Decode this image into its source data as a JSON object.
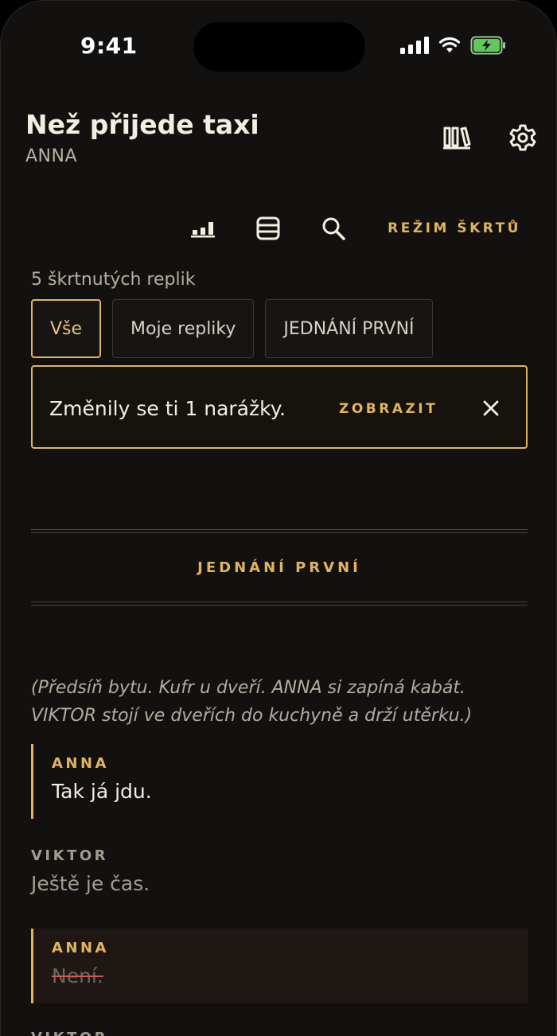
{
  "status_bar": {
    "time": "9:41"
  },
  "header": {
    "title": "Než přijede taxi",
    "subtitle": "ANNA"
  },
  "toolbar": {
    "cut_mode_label": "REŽIM ŠKRTŮ"
  },
  "cut_count": "5 škrtnutých replik",
  "filters": [
    {
      "label": "Vše",
      "active": true
    },
    {
      "label": "Moje repliky",
      "active": false
    },
    {
      "label": "JEDNÁNÍ PRVNÍ",
      "active": false
    }
  ],
  "notice": {
    "text": "Změnily se ti 1 narážky.",
    "action": "ZOBRAZIT"
  },
  "section": {
    "title": "JEDNÁNÍ PRVNÍ"
  },
  "stage_direction": "(Předsíň bytu. Kufr u dveří. ANNA si zapíná kabát. VIKTOR stojí ve dveřích do kuchyně a drží utěrku.)",
  "lines": [
    {
      "speaker": "ANNA",
      "text": "Tak já jdu.",
      "mine": true,
      "cut": false
    },
    {
      "speaker": "VIKTOR",
      "text": "Ještě je čas.",
      "mine": false,
      "cut": false
    },
    {
      "speaker": "ANNA",
      "text": "Není.",
      "mine": true,
      "cut": true
    },
    {
      "speaker": "VIKTOR",
      "text": "",
      "mine": false,
      "cut": false
    }
  ],
  "colors": {
    "accent": "#e2b45e",
    "background": "#131110",
    "cut_strike": "#d25a4d"
  }
}
